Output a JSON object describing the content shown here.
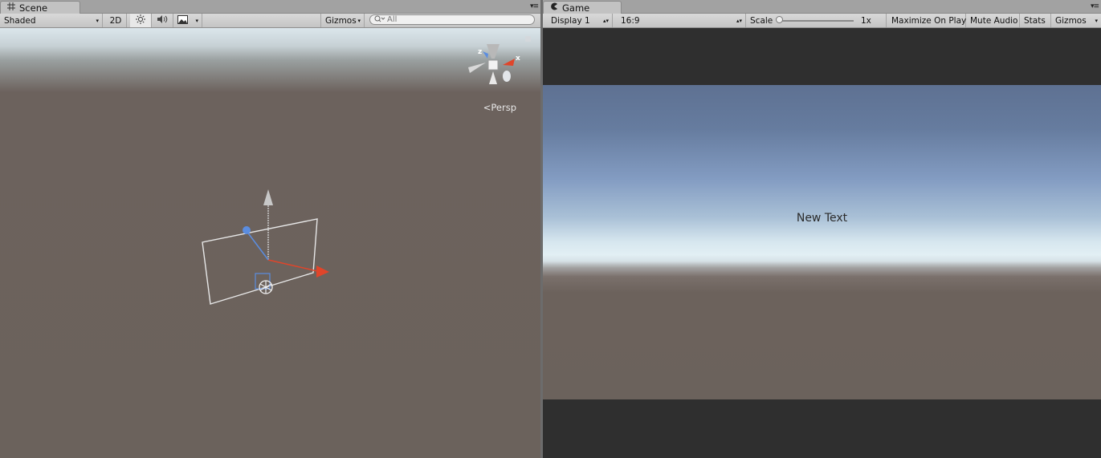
{
  "scene": {
    "tab_label": "Scene",
    "tab_icon": "grid-icon",
    "toolbar": {
      "shading_mode": "Shaded",
      "mode_2d_label": "2D",
      "lighting_icon": "sun-icon",
      "audio_icon": "speaker-icon",
      "effects_icon": "image-icon",
      "gizmos_label": "Gizmos",
      "search_placeholder": "All"
    },
    "view": {
      "projection_label": "Persp",
      "axis_x_label": "x",
      "axis_z_label": "z"
    }
  },
  "game": {
    "tab_label": "Game",
    "tab_icon": "pacman-icon",
    "toolbar": {
      "display": "Display 1",
      "aspect": "16:9",
      "scale_label": "Scale",
      "scale_value": "1x",
      "scale_fraction": 0.0,
      "maximize_label": "Maximize On Play",
      "mute_label": "Mute Audio",
      "stats_label": "Stats",
      "gizmos_label": "Gizmos"
    },
    "view": {
      "text": "New Text"
    }
  },
  "colors": {
    "ground": "#6b625c",
    "sky": "#839cc2",
    "letterbox": "#2f2f2f",
    "axis_x": "#e0452a",
    "axis_y": "#c8c8c8",
    "axis_z": "#5b8de0"
  }
}
